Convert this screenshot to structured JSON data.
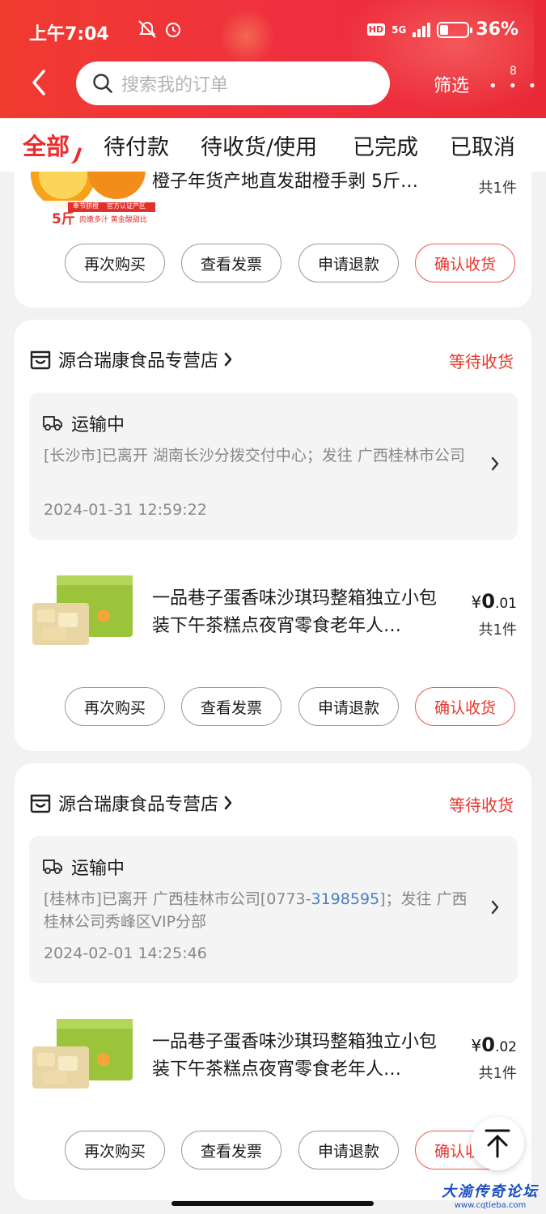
{
  "status_bar": {
    "time": "上午7:04",
    "hd": "HD",
    "network": "5G",
    "battery": "36%"
  },
  "header": {
    "search_placeholder": "搜索我的订单",
    "filter_label": "筛选",
    "more_badge": "8"
  },
  "tabs": [
    {
      "label": "全部",
      "active": true
    },
    {
      "label": "待付款",
      "active": false
    },
    {
      "label": "待收货/使用",
      "active": false
    },
    {
      "label": "已完成",
      "active": false
    },
    {
      "label": "已取消",
      "active": false
    }
  ],
  "buttons": {
    "rebuy": "再次购买",
    "invoice": "查看发票",
    "refund": "申请退款",
    "confirm": "确认收货"
  },
  "orders": [
    {
      "product": {
        "title": "橙子年货产地直发甜橙手剥 5斤…",
        "qty": "共1件",
        "image_text": {
          "badge1": "奉节脐橙",
          "badge2": "官方认证产区",
          "weight": "5斤",
          "slogan": "肉嫩多汁 黄金酸甜比"
        }
      }
    },
    {
      "shop": "源合瑞康食品专营店",
      "status": "等待收货",
      "logistics": {
        "title": "运输中",
        "desc_pre": "[长沙市]已离开 湖南长沙分拨交付中心；发往 广西桂林市公司",
        "phone": "",
        "desc_post": "",
        "time": "2024-01-31 12:59:22"
      },
      "product": {
        "title": "一品巷子蛋香味沙琪玛整箱独立小包装下午茶糕点夜宵零食老年人…",
        "price_sym": "¥",
        "price_int": "0",
        "price_dec": ".01",
        "qty": "共1件"
      }
    },
    {
      "shop": "源合瑞康食品专营店",
      "status": "等待收货",
      "logistics": {
        "title": "运输中",
        "desc_pre": "[桂林市]已离开 广西桂林市公司[0773-",
        "phone": "3198595",
        "desc_post": "]；发往 广西桂林公司秀峰区VIP分部",
        "time": "2024-02-01 14:25:46"
      },
      "product": {
        "title": "一品巷子蛋香味沙琪玛整箱独立小包装下午茶糕点夜宵零食老年人…",
        "price_sym": "¥",
        "price_int": "0",
        "price_dec": ".02",
        "qty": "共1件"
      }
    }
  ],
  "watermark": {
    "line1": "大渝传奇论坛",
    "line2": "www.cqtieba.com"
  }
}
